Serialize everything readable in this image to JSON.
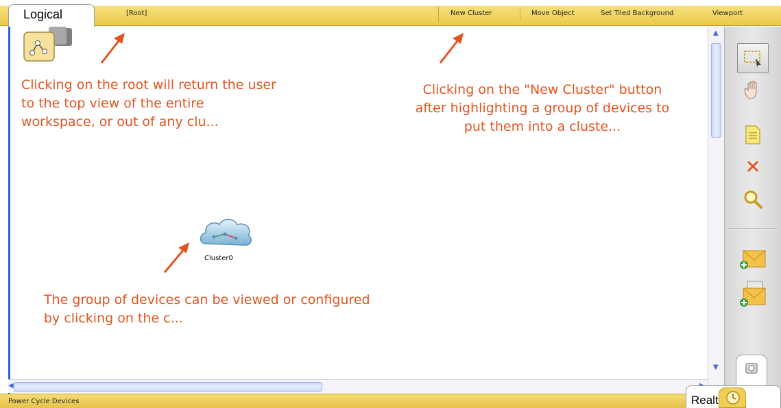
{
  "toolbar": {
    "tab_label": "Logical",
    "root": "[Root]",
    "new_cluster": "New Cluster",
    "move_object": "Move Object",
    "set_tiled_background": "Set Tiled Background",
    "viewport": "Viewport"
  },
  "annotations": {
    "root_note": "Clicking on the root will return the user\nto the top view of the entire\nworkspace, or out of any clu...",
    "cluster_note": "Clicking on the \"New Cluster\" button\nafter highlighting a group of devices to\nput them into a cluste...",
    "group_note": "The group of devices can be viewed or configured\nby clicking on the c..."
  },
  "workspace": {
    "cluster_label": "Cluster0"
  },
  "tools": [
    {
      "icon": "select-icon",
      "selected": true
    },
    {
      "icon": "hand-icon",
      "selected": false
    },
    {
      "icon": "note-icon",
      "selected": false
    },
    {
      "icon": "delete-icon",
      "selected": false
    },
    {
      "icon": "inspect-icon",
      "selected": false
    },
    {
      "icon": "add-simple-pdu-icon",
      "selected": false
    },
    {
      "icon": "add-complex-pdu-icon",
      "selected": false
    }
  ],
  "statusbar": {
    "power_cycle": "Power Cycle Devices",
    "mode_tab": "Realtime"
  },
  "colors": {
    "toolbar_yellow": "#ecc94a",
    "annotation_orange": "#e2541f",
    "scroll_blue": "#2f5fd1",
    "delete_red": "#e0561e"
  }
}
